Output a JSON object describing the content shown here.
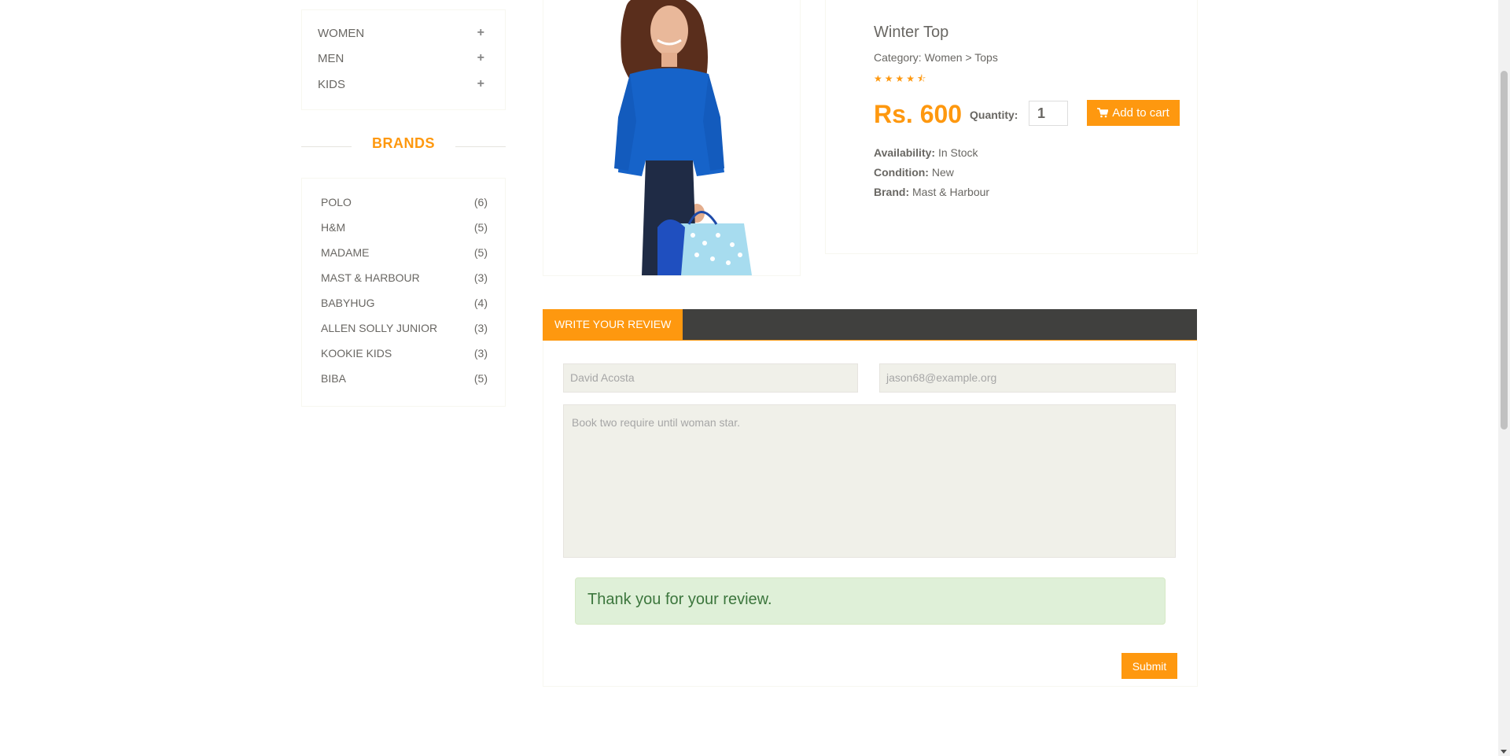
{
  "sidebar": {
    "categories": [
      "WOMEN",
      "MEN",
      "KIDS"
    ],
    "brands_title": "BRANDS",
    "brands": [
      {
        "name": "POLO",
        "count": "(6)"
      },
      {
        "name": "H&M",
        "count": "(5)"
      },
      {
        "name": "MADAME",
        "count": "(5)"
      },
      {
        "name": "MAST & HARBOUR",
        "count": "(3)"
      },
      {
        "name": "BABYHUG",
        "count": "(4)"
      },
      {
        "name": "ALLEN SOLLY JUNIOR",
        "count": "(3)"
      },
      {
        "name": "KOOKIE KIDS",
        "count": "(3)"
      },
      {
        "name": "BIBA",
        "count": "(5)"
      }
    ]
  },
  "product": {
    "title": "Winter Top",
    "category": "Category: Women > Tops",
    "rating": 4.5,
    "price": "Rs. 600",
    "quantity_label": "Quantity:",
    "quantity": "1",
    "add_to_cart": "Add to cart",
    "availability_label": "Availability:",
    "availability": "In Stock",
    "condition_label": "Condition:",
    "condition": "New",
    "brand_label": "Brand:",
    "brand": "Mast & Harbour"
  },
  "review": {
    "tab_label": "WRITE YOUR REVIEW",
    "name_value": "David Acosta",
    "email_value": "jason68@example.org",
    "review_text": "Book two require until woman star.",
    "success_message": "Thank you for your review.",
    "submit_label": "Submit"
  },
  "colors": {
    "accent": "#FE980F",
    "dark_bar": "#40403E",
    "success_bg": "#DFF0D8",
    "success_text": "#3C763D",
    "input_bg": "#F0F0E9"
  }
}
